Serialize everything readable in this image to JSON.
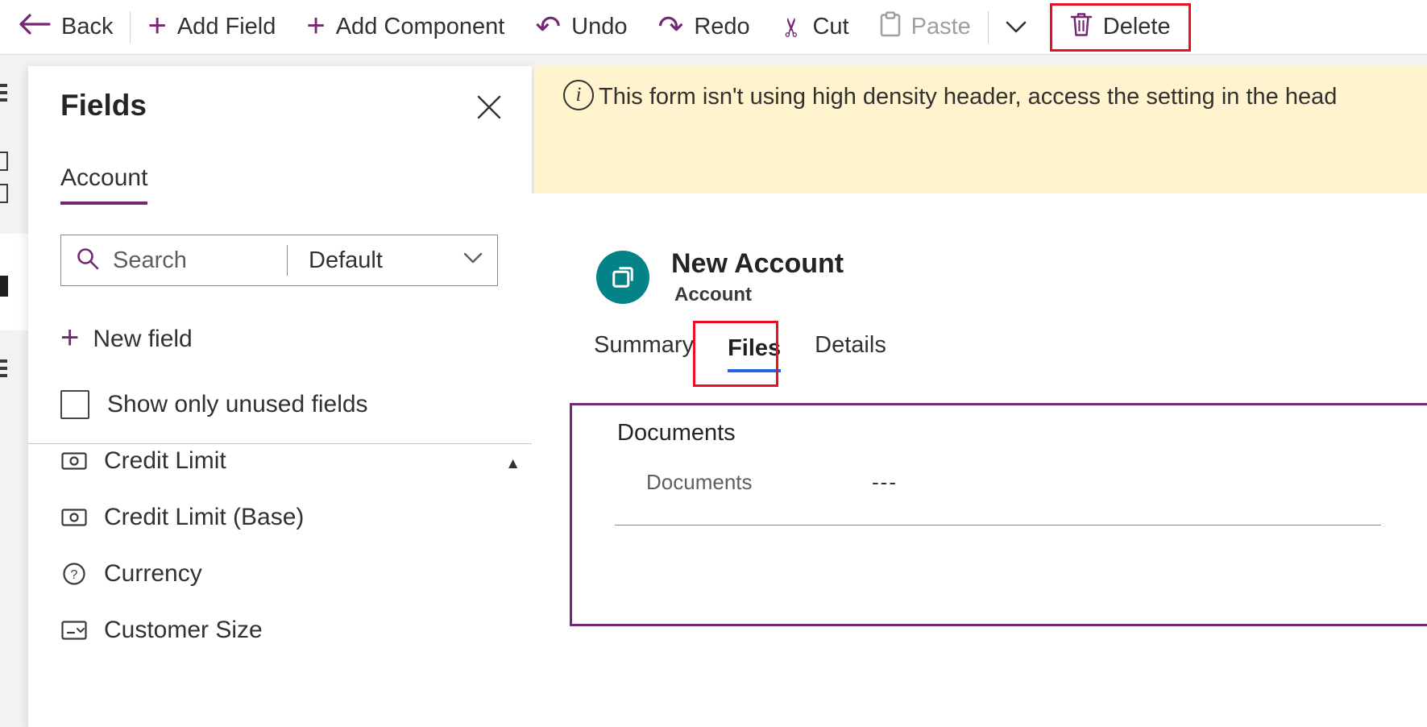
{
  "toolbar": {
    "back_label": "Back",
    "add_field_label": "Add Field",
    "add_component_label": "Add Component",
    "undo_label": "Undo",
    "redo_label": "Redo",
    "cut_label": "Cut",
    "paste_label": "Paste",
    "delete_label": "Delete"
  },
  "left_panel": {
    "title": "Fields",
    "entity_tab": "Account",
    "search": {
      "placeholder": "Search",
      "filter_selected": "Default"
    },
    "new_field_label": "New field",
    "show_unused_label": "Show only unused fields",
    "fields": [
      {
        "label": "Credit Limit",
        "icon": "money-icon"
      },
      {
        "label": "Credit Limit (Base)",
        "icon": "money-icon"
      },
      {
        "label": "Currency",
        "icon": "help-circle-icon"
      },
      {
        "label": "Customer Size",
        "icon": "option-set-icon"
      }
    ]
  },
  "banner": {
    "message": "This form isn't using high density header, access the setting in the head"
  },
  "canvas": {
    "record_title": "New Account",
    "record_subtitle": "Account",
    "tabs": [
      {
        "label": "Summary",
        "selected": false
      },
      {
        "label": "Files",
        "selected": true
      },
      {
        "label": "Details",
        "selected": false
      }
    ],
    "section": {
      "title": "Documents",
      "field_label": "Documents",
      "field_value": "---"
    }
  },
  "colors": {
    "accent_purple": "#742774",
    "highlight_red": "#e81123",
    "tab_underline_blue": "#2266e3",
    "entity_icon_teal": "#038387",
    "banner_bg": "#fff4ce"
  }
}
